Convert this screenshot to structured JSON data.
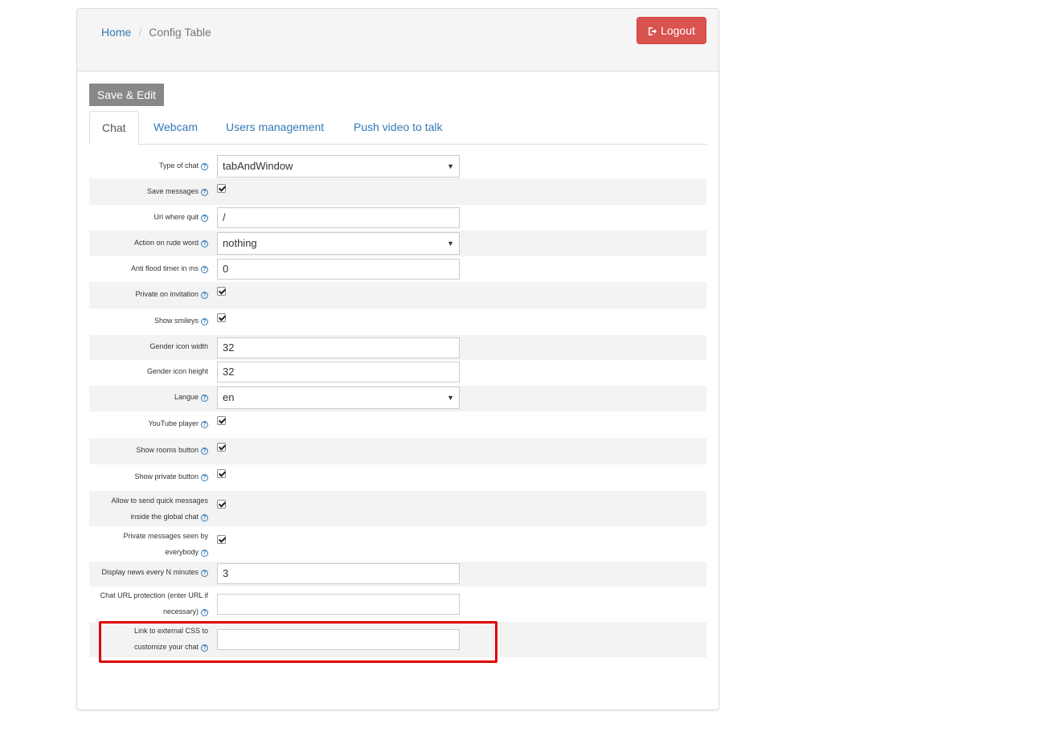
{
  "breadcrumb": {
    "home": "Home",
    "separator": "/",
    "current": "Config Table"
  },
  "header": {
    "logout_label": "Logout",
    "logout_icon": "sign-out-icon"
  },
  "toolbar": {
    "save_label": "Save & Edit"
  },
  "tabs": [
    {
      "label": "Chat",
      "active": true
    },
    {
      "label": "Webcam",
      "active": false
    },
    {
      "label": "Users management",
      "active": false
    },
    {
      "label": "Push video to talk",
      "active": false
    }
  ],
  "help_icon_glyph": "?",
  "fields": {
    "type_of_chat": {
      "label": "Type of chat",
      "value": "tabAndWindow"
    },
    "save_messages": {
      "label": "Save messages",
      "checked": true
    },
    "url_where_quit": {
      "label": "Url where quit",
      "value": "/"
    },
    "action_on_rude_word": {
      "label": "Action on rude word",
      "value": "nothing"
    },
    "anti_flood_timer": {
      "label": "Anti flood timer in ms",
      "value": "0"
    },
    "private_on_invitation": {
      "label": "Private on invitation",
      "checked": true
    },
    "show_smileys": {
      "label": "Show smileys",
      "checked": true
    },
    "gender_icon_width": {
      "label": "Gender icon width",
      "value": "32"
    },
    "gender_icon_height": {
      "label": "Gender icon height",
      "value": "32"
    },
    "langue": {
      "label": "Langue",
      "value": "en"
    },
    "youtube_player": {
      "label": "YouTube player",
      "checked": true
    },
    "show_rooms_button": {
      "label": "Show rooms button",
      "checked": true
    },
    "show_private_button": {
      "label": "Show private button",
      "checked": true
    },
    "quick_messages": {
      "label_line1": "Allow to send quick messages",
      "label_line2": "inside the global chat",
      "checked": true
    },
    "private_seen_by_everybody": {
      "label_line1": "Private messages seen by",
      "label_line2": "everybody",
      "checked": true
    },
    "display_news": {
      "label": "Display news every N minutes",
      "value": "3"
    },
    "chat_url_protection": {
      "label_line1": "Chat URL protection (enter URL if",
      "label_line2": "necessary)",
      "value": ""
    },
    "external_css": {
      "label_line1": "Link to external CSS to",
      "label_line2": "customize your chat",
      "value": ""
    }
  },
  "select_caret": "▼",
  "colors": {
    "accent": "#337ab7",
    "danger": "#d9534f",
    "save_button": "#888888",
    "highlight": "#e00000"
  }
}
